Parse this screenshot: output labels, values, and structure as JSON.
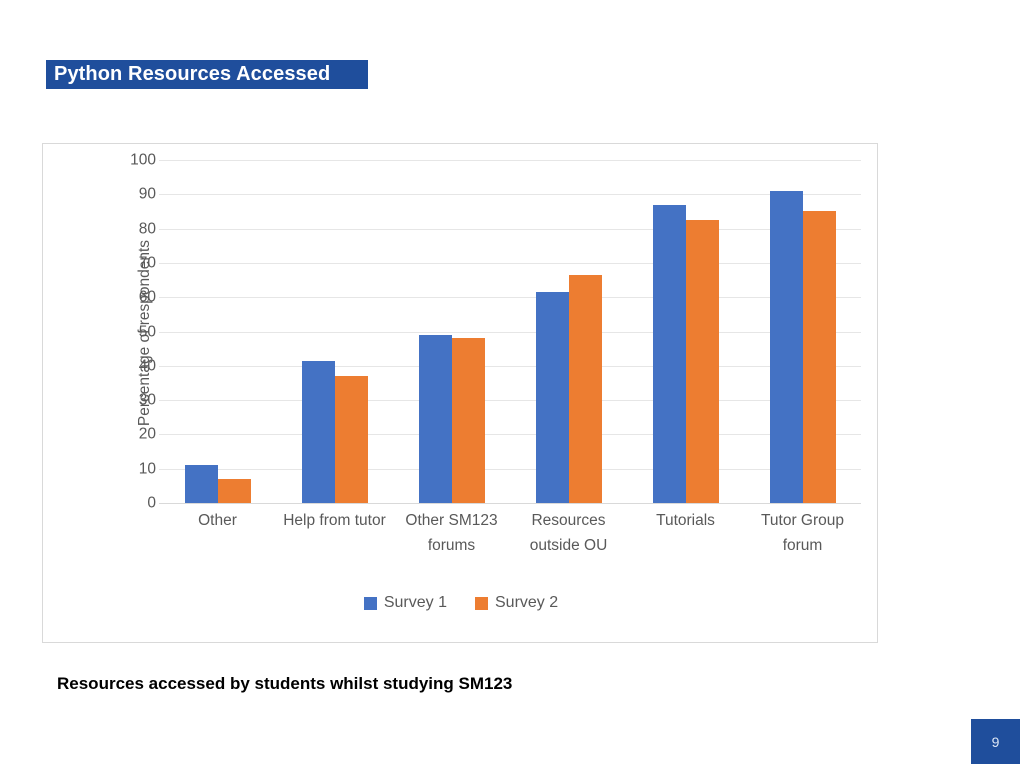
{
  "slide": {
    "title": "Python Resources Accessed",
    "caption": "Resources accessed by students whilst studying SM123",
    "page_number": "9",
    "title_bar_color": "#1F4E9C",
    "page_badge_color": "#1F4E9C"
  },
  "chart_data": {
    "type": "bar",
    "title": "",
    "xlabel": "",
    "ylabel": "Percentage of respondents",
    "ylim": [
      0,
      100
    ],
    "ytick_step": 10,
    "yticks": [
      100,
      90,
      80,
      70,
      60,
      50,
      40,
      30,
      20,
      10,
      0
    ],
    "grid": true,
    "legend_position": "bottom",
    "categories": [
      "Other",
      "Help from tutor",
      "Other SM123 forums",
      "Resources outside OU",
      "Tutorials",
      "Tutor Group forum"
    ],
    "series": [
      {
        "name": "Survey 1",
        "color": "#4472C4",
        "values": [
          11,
          41.5,
          49,
          61.5,
          87,
          91
        ]
      },
      {
        "name": "Survey 2",
        "color": "#ED7D31",
        "values": [
          7,
          37,
          48,
          66.5,
          82.5,
          85
        ]
      }
    ]
  }
}
